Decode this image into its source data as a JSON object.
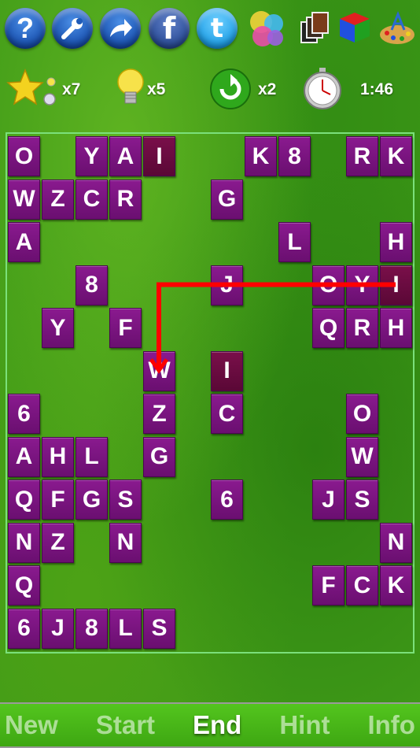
{
  "toolbar": {
    "icons": [
      "help-icon",
      "wrench-icon",
      "share-arrow-icon",
      "facebook-icon",
      "twitter-icon",
      "game-center-icon",
      "cards-icon",
      "cube-icon",
      "palette-icon"
    ],
    "help_glyph": "?",
    "facebook_glyph": "f",
    "twitter_glyph": "t"
  },
  "status": {
    "stars": "x7",
    "hints": "x5",
    "shuffles": "x2",
    "time": "1:46"
  },
  "board": {
    "selected_color": "#6a0a3e",
    "tile_color": "#7d1483",
    "path_color": "#ff0000",
    "tiles": [
      {
        "c": "O",
        "col": 0,
        "row": 0
      },
      {
        "c": "Y",
        "col": 2,
        "row": 0
      },
      {
        "c": "A",
        "col": 3,
        "row": 0
      },
      {
        "c": "I",
        "col": 4,
        "row": 0,
        "sel": true
      },
      {
        "c": "K",
        "col": 7,
        "row": 0
      },
      {
        "c": "8",
        "col": 8,
        "row": 0
      },
      {
        "c": "R",
        "col": 10,
        "row": 0
      },
      {
        "c": "K",
        "col": 11,
        "row": 0
      },
      {
        "c": "W",
        "col": 0,
        "row": 1
      },
      {
        "c": "Z",
        "col": 1,
        "row": 1
      },
      {
        "c": "C",
        "col": 2,
        "row": 1
      },
      {
        "c": "R",
        "col": 3,
        "row": 1
      },
      {
        "c": "G",
        "col": 6,
        "row": 1
      },
      {
        "c": "A",
        "col": 0,
        "row": 2
      },
      {
        "c": "L",
        "col": 8,
        "row": 2
      },
      {
        "c": "H",
        "col": 11,
        "row": 2
      },
      {
        "c": "8",
        "col": 2,
        "row": 3
      },
      {
        "c": "J",
        "col": 6,
        "row": 3
      },
      {
        "c": "O",
        "col": 9,
        "row": 3
      },
      {
        "c": "Y",
        "col": 10,
        "row": 3
      },
      {
        "c": "I",
        "col": 11,
        "row": 3,
        "sel": true
      },
      {
        "c": "Y",
        "col": 1,
        "row": 4
      },
      {
        "c": "F",
        "col": 3,
        "row": 4
      },
      {
        "c": "Q",
        "col": 9,
        "row": 4
      },
      {
        "c": "R",
        "col": 10,
        "row": 4
      },
      {
        "c": "H",
        "col": 11,
        "row": 4
      },
      {
        "c": "W",
        "col": 4,
        "row": 5
      },
      {
        "c": "I",
        "col": 6,
        "row": 5,
        "sel": true
      },
      {
        "c": "6",
        "col": 0,
        "row": 6
      },
      {
        "c": "Z",
        "col": 4,
        "row": 6
      },
      {
        "c": "C",
        "col": 6,
        "row": 6
      },
      {
        "c": "O",
        "col": 10,
        "row": 6
      },
      {
        "c": "A",
        "col": 0,
        "row": 7
      },
      {
        "c": "H",
        "col": 1,
        "row": 7
      },
      {
        "c": "L",
        "col": 2,
        "row": 7
      },
      {
        "c": "G",
        "col": 4,
        "row": 7
      },
      {
        "c": "W",
        "col": 10,
        "row": 7
      },
      {
        "c": "Q",
        "col": 0,
        "row": 8
      },
      {
        "c": "F",
        "col": 1,
        "row": 8
      },
      {
        "c": "G",
        "col": 2,
        "row": 8
      },
      {
        "c": "S",
        "col": 3,
        "row": 8
      },
      {
        "c": "6",
        "col": 6,
        "row": 8
      },
      {
        "c": "J",
        "col": 9,
        "row": 8
      },
      {
        "c": "S",
        "col": 10,
        "row": 8
      },
      {
        "c": "N",
        "col": 0,
        "row": 9
      },
      {
        "c": "Z",
        "col": 1,
        "row": 9
      },
      {
        "c": "N",
        "col": 3,
        "row": 9
      },
      {
        "c": "N",
        "col": 11,
        "row": 9
      },
      {
        "c": "Q",
        "col": 0,
        "row": 10
      },
      {
        "c": "F",
        "col": 9,
        "row": 10
      },
      {
        "c": "C",
        "col": 10,
        "row": 10
      },
      {
        "c": "K",
        "col": 11,
        "row": 10
      },
      {
        "c": "6",
        "col": 0,
        "row": 11
      },
      {
        "c": "J",
        "col": 1,
        "row": 11
      },
      {
        "c": "8",
        "col": 2,
        "row": 11
      },
      {
        "c": "L",
        "col": 3,
        "row": 11
      },
      {
        "c": "S",
        "col": 4,
        "row": 11
      }
    ],
    "path": [
      {
        "col": 11,
        "row": 3
      },
      {
        "col": 4,
        "row": 3
      },
      {
        "col": 4,
        "row": 5
      }
    ]
  },
  "menu": {
    "items": [
      {
        "name": "new",
        "label": "New",
        "active": false
      },
      {
        "name": "start",
        "label": "Start",
        "active": false
      },
      {
        "name": "end",
        "label": "End",
        "active": true
      },
      {
        "name": "hint",
        "label": "Hint",
        "active": false
      },
      {
        "name": "info",
        "label": "Info",
        "active": false
      }
    ]
  }
}
